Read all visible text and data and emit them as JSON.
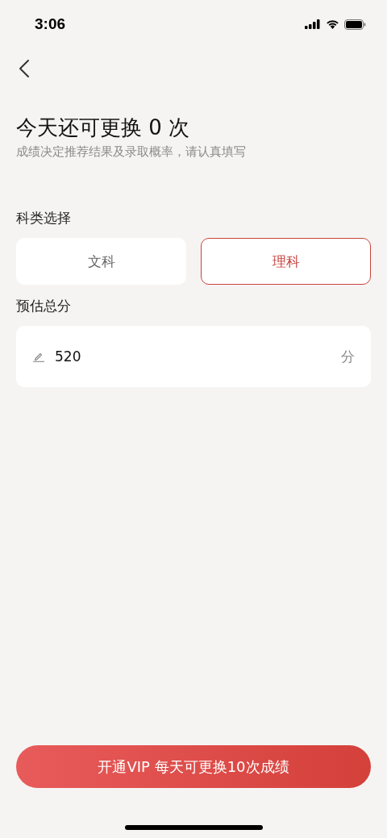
{
  "status_bar": {
    "time": "3:06"
  },
  "header": {
    "title": "今天还可更换 0 次",
    "subtitle": "成绩决定推荐结果及录取概率，请认真填写"
  },
  "subject": {
    "label": "科类选择",
    "options": [
      {
        "label": "文科",
        "selected": false
      },
      {
        "label": "理科",
        "selected": true
      }
    ]
  },
  "score": {
    "label": "预估总分",
    "value": "520",
    "unit": "分"
  },
  "vip_button": {
    "label": "开通VIP 每天可更换10次成绩"
  }
}
